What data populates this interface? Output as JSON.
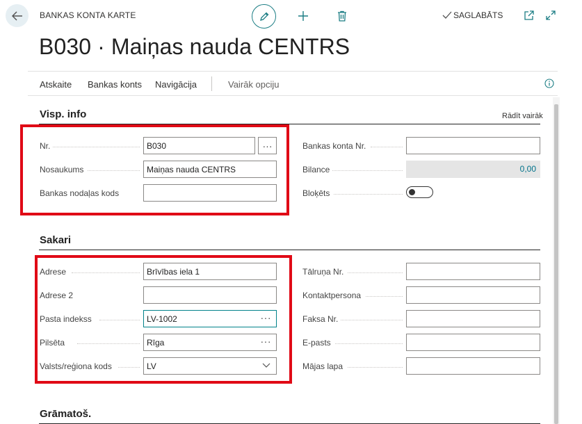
{
  "header": {
    "caption": "BANKAS KONTA KARTE",
    "saved_label": "SAGLABĀTS",
    "title": "B030 · Maiņas nauda CENTRS"
  },
  "icons": {
    "back": "back-arrow-icon",
    "edit": "pencil-icon",
    "add": "plus-icon",
    "delete": "trash-icon",
    "saved": "check-icon",
    "popout": "popout-icon",
    "expand": "expand-icon",
    "info": "info-icon"
  },
  "actions": {
    "report": "Atskaite",
    "bank_account": "Bankas konts",
    "navigation": "Navigācija",
    "more": "Vairāk opciju"
  },
  "general": {
    "title": "Visp. info",
    "show_more": "Rādīt vairāk",
    "no_label": "Nr.",
    "no_value": "B030",
    "name_label": "Nosaukums",
    "name_value": "Maiņas nauda CENTRS",
    "branch_label": "Bankas nodaļas kods",
    "branch_value": "",
    "account_no_label": "Bankas konta Nr.",
    "account_no_value": "",
    "balance_label": "Bilance",
    "balance_value": "0,00",
    "blocked_label": "Bloķēts",
    "blocked_value": false
  },
  "contact": {
    "title": "Sakari",
    "address_label": "Adrese",
    "address_value": "Brīvības iela 1",
    "address2_label": "Adrese 2",
    "address2_value": "",
    "postcode_label": "Pasta indekss",
    "postcode_value": "LV-1002",
    "city_label": "Pilsēta",
    "city_value": "Rīga",
    "country_label": "Valsts/reģiona kods",
    "country_value": "LV",
    "phone_label": "Tālruņa Nr.",
    "phone_value": "",
    "contact_label": "Kontaktpersona",
    "contact_value": "",
    "fax_label": "Faksa Nr.",
    "fax_value": "",
    "email_label": "E-pasts",
    "email_value": "",
    "homepage_label": "Mājas lapa",
    "homepage_value": ""
  },
  "posting": {
    "title": "Grāmatoš."
  },
  "colors": {
    "accent": "#00828a",
    "highlight": "#e00a16",
    "back_button_bg": "#e6eff3"
  }
}
